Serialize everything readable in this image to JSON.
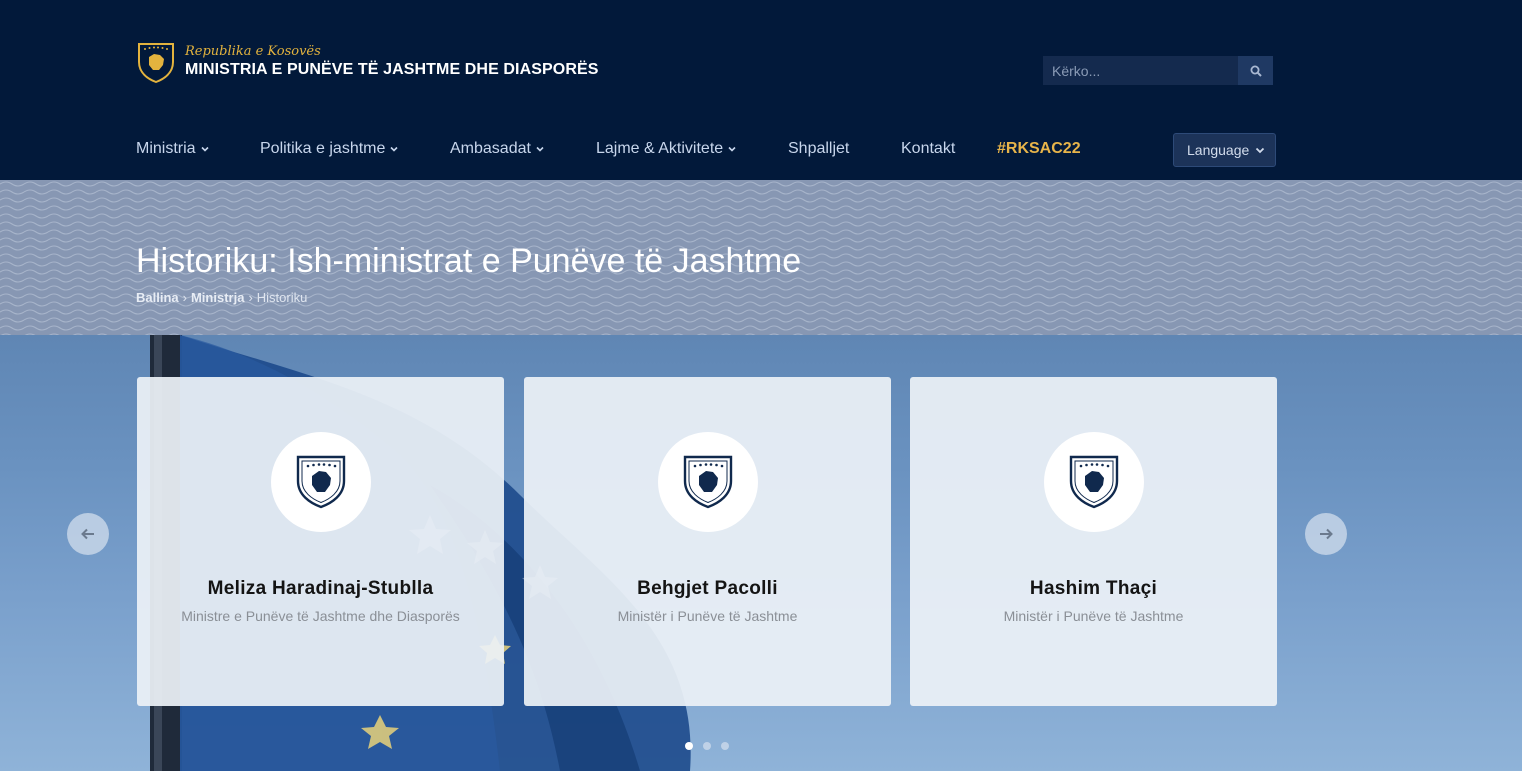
{
  "header": {
    "logo_subtitle": "Republika e Kosovës",
    "logo_title": "MINISTRIA E PUNËVE TË JASHTME DHE DIASPORËS",
    "search_placeholder": "Kërko...",
    "search_icon": "search-icon"
  },
  "nav": {
    "items": [
      {
        "label": "Ministria",
        "dropdown": true
      },
      {
        "label": "Politika e jashtme",
        "dropdown": true
      },
      {
        "label": "Ambasadat",
        "dropdown": true
      },
      {
        "label": "Lajme & Aktivitete",
        "dropdown": true
      },
      {
        "label": "Shpalljet",
        "dropdown": false
      },
      {
        "label": "Kontakt",
        "dropdown": false
      },
      {
        "label": "#RKSAC22",
        "dropdown": false,
        "highlight": true
      }
    ],
    "language_label": "Language"
  },
  "page": {
    "title": "Historiku: Ish-ministrat e Punëve të Jashtme",
    "breadcrumb": [
      "Ballina",
      "Ministrja",
      "Historiku"
    ],
    "breadcrumb_separator": "›"
  },
  "carousel": {
    "cards": [
      {
        "name": "Meliza Haradinaj-Stublla",
        "role": "Ministre e Punëve të Jashtme dhe Diasporës",
        "icon": "kosovo-emblem-icon"
      },
      {
        "name": "Behgjet Pacolli",
        "role": "Ministër i Punëve të Jashtme",
        "icon": "kosovo-emblem-icon"
      },
      {
        "name": "Hashim Thaçi",
        "role": "Ministër i Punëve të Jashtme",
        "icon": "kosovo-emblem-icon"
      }
    ],
    "active_dot": 0,
    "dot_count": 3,
    "prev_icon": "arrow-left-icon",
    "next_icon": "arrow-right-icon"
  },
  "colors": {
    "header_bg": "#02193a",
    "accent_gold": "#e3b33e",
    "nav_text": "#c8d6ec",
    "band_bg": "#8797b3"
  }
}
